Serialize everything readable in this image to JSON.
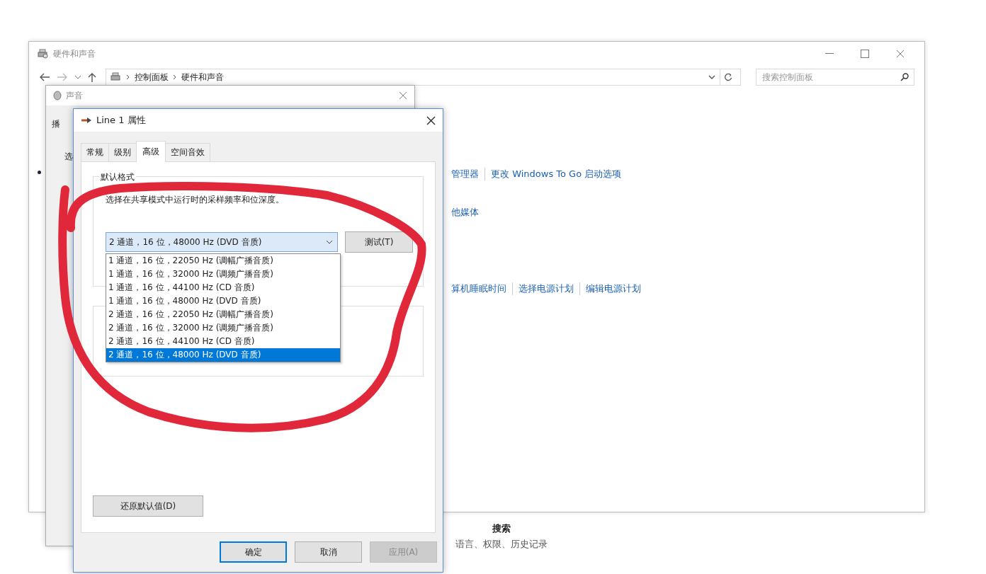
{
  "control_panel": {
    "title": "硬件和声音",
    "breadcrumb": [
      "控制面板",
      "硬件和声音"
    ],
    "search": {
      "placeholder": "搜索控制面板"
    },
    "link_rows": [
      [
        "管理器",
        "更改 Windows To Go 启动选项"
      ],
      [
        "他媒体"
      ],
      [
        "算机睡眠时间",
        "选择电源计划",
        "编辑电源计划"
      ]
    ],
    "section": {
      "title": "搜索",
      "links": "语言、权限、历史记录"
    }
  },
  "sound_dialog": {
    "title": "声音",
    "tab": "播",
    "label": "选"
  },
  "properties_dialog": {
    "title": "Line 1 属性",
    "tabs": [
      {
        "label": "常规",
        "selected": false
      },
      {
        "label": "级别",
        "selected": false
      },
      {
        "label": "高级",
        "selected": true
      },
      {
        "label": "空间音效",
        "selected": false
      }
    ],
    "group": "默认格式",
    "description": "选择在共享模式中运行时的采样频率和位深度。",
    "format": {
      "value": "2 通道，16 位，48000 Hz (DVD 音质)",
      "options": [
        {
          "label": "1 通道，16 位，22050 Hz (调幅广播音质)",
          "selected": false
        },
        {
          "label": "1 通道，16 位，32000 Hz (调频广播音质)",
          "selected": false
        },
        {
          "label": "1 通道，16 位，44100 Hz (CD 音质)",
          "selected": false
        },
        {
          "label": "1 通道，16 位，48000 Hz (DVD 音质)",
          "selected": false
        },
        {
          "label": "2 通道，16 位，22050 Hz (调幅广播音质)",
          "selected": false
        },
        {
          "label": "2 通道，16 位，32000 Hz (调频广播音质)",
          "selected": false
        },
        {
          "label": "2 通道，16 位，44100 Hz (CD 音质)",
          "selected": false
        },
        {
          "label": "2 通道，16 位，48000 Hz (DVD 音质)",
          "selected": true
        }
      ]
    },
    "test_button": "测试(T)",
    "restore_button": "还原默认值(D)",
    "buttons": [
      {
        "label": "确定",
        "default": true,
        "disabled": false
      },
      {
        "label": "取消",
        "default": false,
        "disabled": false
      },
      {
        "label": "应用(A)",
        "default": false,
        "disabled": true
      }
    ]
  }
}
